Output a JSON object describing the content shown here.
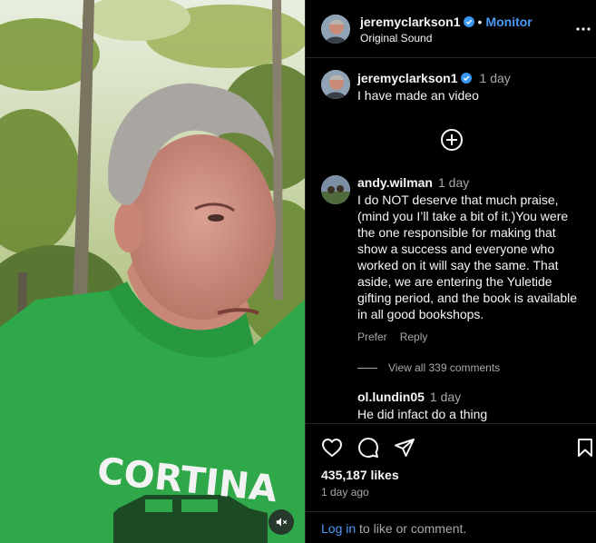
{
  "post": {
    "username": "jeremyclarkson1",
    "follow_label": "Monitor",
    "audio": "Original Sound",
    "mute_icon": "muted-speaker-icon",
    "shirt_text": "CORTINA"
  },
  "caption": {
    "username": "jeremyclarkson1",
    "time": "1 day",
    "text": "I have made an video"
  },
  "comment": {
    "username": "andy.wilman",
    "time": "1 day",
    "lines": [
      "I do NOT deserve that much praise,",
      "(mind you I’ll take a bit of it.)You were",
      "the one responsible for making that",
      "show a success and everyone who",
      "worked on it will say the same. That",
      "aside, we are entering the Yuletide",
      "gifting period, and the book is available",
      "in all good bookshops."
    ],
    "like_label": "Prefer",
    "reply_label": "Reply"
  },
  "view_all": "View all 339 comments",
  "reply": {
    "username": "ol.lundin05",
    "time": "1 day",
    "text": "He did infact do a thing"
  },
  "stats": {
    "likes": "435,187 likes",
    "posted": "1 day ago"
  },
  "login": {
    "link": "Log in",
    "rest": " to like or comment."
  },
  "colors": {
    "background": "#000000",
    "accent_link": "#4a9bf6",
    "verified_badge": "#3897f0",
    "muted_text": "#a8a8a8",
    "shirt_green": "#2fa84a"
  }
}
